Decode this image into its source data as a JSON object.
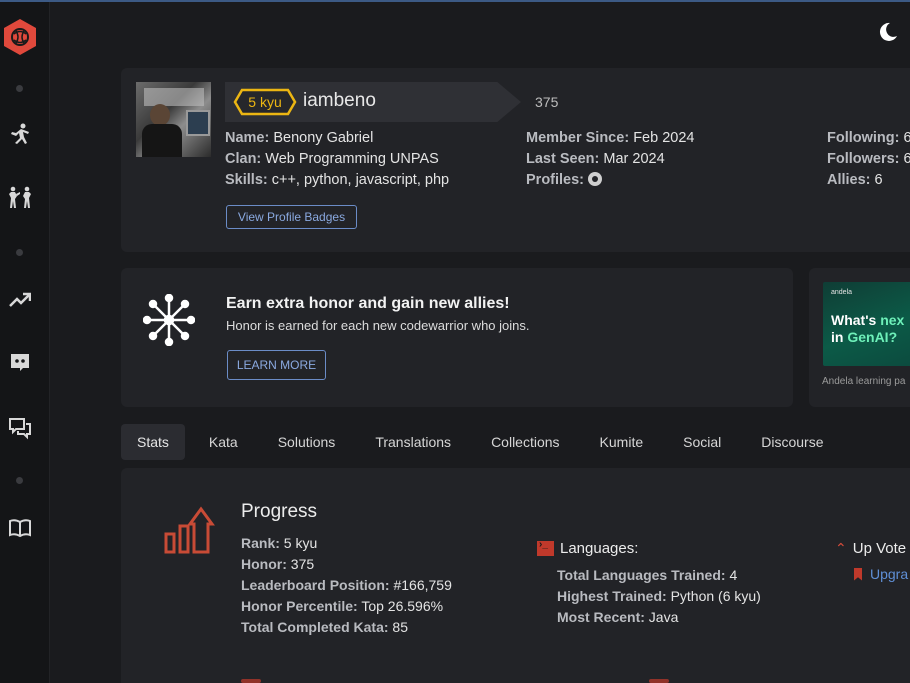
{
  "profile": {
    "rank_badge": "5 kyu",
    "username": "iambeno",
    "honor": "375",
    "col1": [
      {
        "label": "Name:",
        "value": "Benony Gabriel"
      },
      {
        "label": "Clan:",
        "value": "Web Programming UNPAS"
      },
      {
        "label": "Skills:",
        "value": "c++, python, javascript, php"
      }
    ],
    "col2": [
      {
        "label": "Member Since:",
        "value": "Feb 2024"
      },
      {
        "label": "Last Seen:",
        "value": "Mar 2024"
      },
      {
        "label": "Profiles:",
        "value": ""
      }
    ],
    "col3": [
      {
        "label": "Following:",
        "value": "6"
      },
      {
        "label": "Followers:",
        "value": "6"
      },
      {
        "label": "Allies:",
        "value": "6"
      }
    ],
    "badges_button": "View Profile Badges"
  },
  "honor_promo": {
    "title": "Earn extra honor and gain new allies!",
    "subtitle": "Honor is earned for each new codewarrior who joins.",
    "button": "LEARN MORE"
  },
  "ad": {
    "brand": "andela",
    "line1_a": "What's ",
    "line1_b": "nex",
    "line2_a": "in ",
    "line2_b": "GenAI?",
    "caption": "Andela learning pa"
  },
  "tabs": [
    "Stats",
    "Kata",
    "Solutions",
    "Translations",
    "Collections",
    "Kumite",
    "Social",
    "Discourse"
  ],
  "stats": {
    "progress_title": "Progress",
    "progress": [
      {
        "label": "Rank:",
        "value": "5 kyu"
      },
      {
        "label": "Honor:",
        "value": "375"
      },
      {
        "label": "Leaderboard Position:",
        "value": "#166,759"
      },
      {
        "label": "Honor Percentile:",
        "value": "Top 26.596%"
      },
      {
        "label": "Total Completed Kata:",
        "value": "85"
      }
    ],
    "languages_title": "Languages:",
    "languages": [
      {
        "label": "Total Languages Trained:",
        "value": "4"
      },
      {
        "label": "Highest Trained:",
        "value": "Python (6 kyu)"
      },
      {
        "label": "Most Recent:",
        "value": "Java"
      }
    ],
    "upvotes_title": "Up Vote",
    "upgrade_link": "Upgra"
  },
  "colors": {
    "accent_red": "#d24b3a",
    "rank_yellow": "#ecb613",
    "link_blue": "#8aa9e0"
  }
}
